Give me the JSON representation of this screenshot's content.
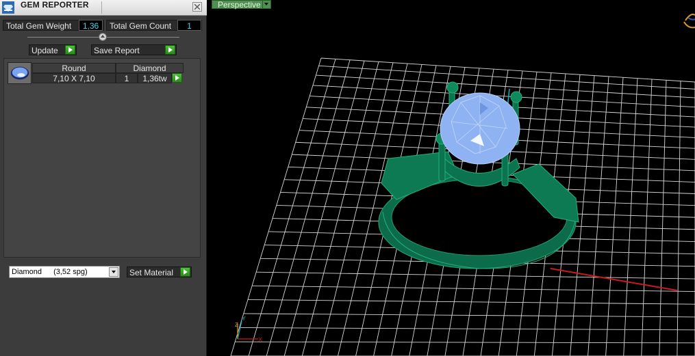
{
  "panel": {
    "title": "GEM REPORTER",
    "total_gem_weight_label": "Total Gem Weight",
    "total_gem_weight_value": "1,36",
    "total_gem_count_label": "Total Gem Count",
    "total_gem_count_value": "1",
    "update_label": "Update",
    "save_report_label": "Save Report",
    "table": {
      "headers": [
        "Round",
        "Diamond"
      ],
      "row": {
        "size": "7,10 X 7,10",
        "count": "1",
        "weight": "1,36tw"
      }
    },
    "material_select": {
      "value": "Diamond",
      "value_detail": "(3,52 spg)"
    },
    "set_material_label": "Set Material"
  },
  "viewport": {
    "view_label": "Perspective",
    "axis_labels": {
      "y": "Y",
      "z": "Z",
      "x": "X"
    }
  },
  "colors": {
    "grid": "#d8d8d8",
    "ring_metal": "#0b6b4a",
    "gem": "#8fb3f2",
    "axis_x": "#cc1a1a",
    "axis_z": "#19a9c0",
    "accent_value": "#4fd1e8",
    "button_green": "#3da62a"
  }
}
